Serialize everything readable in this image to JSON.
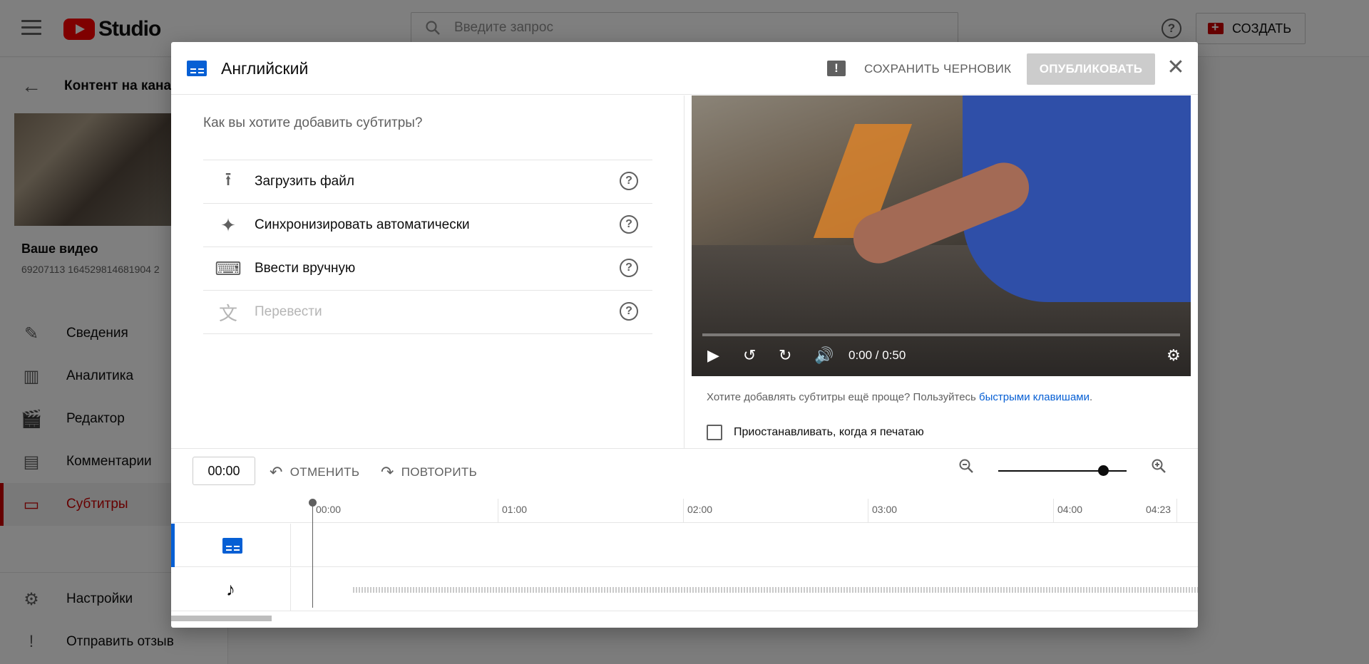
{
  "app": {
    "logo_text": "Studio",
    "search_placeholder": "Введите запрос",
    "help_glyph": "?",
    "create_label": "СОЗДАТЬ"
  },
  "sidebar": {
    "back_title": "Контент на канале",
    "video_title": "Ваше видео",
    "video_sub": "69207113 164529814681904 2",
    "items": [
      {
        "label": "Сведения",
        "icon": "pencil-icon",
        "glyph": "✎"
      },
      {
        "label": "Аналитика",
        "icon": "analytics-icon",
        "glyph": "▥"
      },
      {
        "label": "Редактор",
        "icon": "clapper-icon",
        "glyph": "🎬"
      },
      {
        "label": "Комментарии",
        "icon": "comment-icon",
        "glyph": "▤"
      },
      {
        "label": "Субтитры",
        "icon": "subtitles-icon",
        "glyph": "▭",
        "active": true
      },
      {
        "label": "Настройки",
        "icon": "gear-icon",
        "glyph": "⚙"
      },
      {
        "label": "Отправить отзыв",
        "icon": "feedback-icon",
        "glyph": "!"
      }
    ]
  },
  "dialog": {
    "title": "Английский",
    "feedback_glyph": "!",
    "save_draft": "СОХРАНИТЬ ЧЕРНОВИК",
    "publish": "ОПУБЛИКОВАТЬ",
    "close_glyph": "✕",
    "question": "Как вы хотите добавить субтитры?",
    "options": [
      {
        "label": "Загрузить файл",
        "icon": "upload-icon",
        "glyph": "⭱",
        "disabled": false
      },
      {
        "label": "Синхронизировать автоматически",
        "icon": "sparkle-icon",
        "glyph": "✦",
        "disabled": false
      },
      {
        "label": "Ввести вручную",
        "icon": "keyboard-icon",
        "glyph": "⌨",
        "disabled": false
      },
      {
        "label": "Перевести",
        "icon": "translate-icon",
        "glyph": "文",
        "disabled": true
      }
    ],
    "option_help_glyph": "?",
    "player": {
      "time": "0:00 / 0:50",
      "play_glyph": "▶",
      "rewind_glyph": "↺",
      "forward_glyph": "↻",
      "volume_glyph": "🔊",
      "settings_glyph": "⚙"
    },
    "hint_text": "Хотите добавлять субтитры ещё проще? Пользуйтесь ",
    "hint_link": "быстрыми клавишами",
    "hint_end": ".",
    "pause_label": "Приостанавливать, когда я печатаю"
  },
  "timeline": {
    "current_time": "00:00",
    "undo": "ОТМЕНИТЬ",
    "redo": "ПОВТОРИТЬ",
    "undo_glyph": "↶",
    "redo_glyph": "↷",
    "zoom_out_glyph": "−",
    "zoom_in_glyph": "+",
    "zoom_level": 0.82,
    "ticks": [
      "00:00",
      "01:00",
      "02:00",
      "03:00",
      "04:00",
      "04:23"
    ],
    "note_glyph": "♪"
  },
  "colors": {
    "accent_red": "#cc0000",
    "accent_blue": "#065fd4",
    "publish_disabled": "#cccccc"
  }
}
